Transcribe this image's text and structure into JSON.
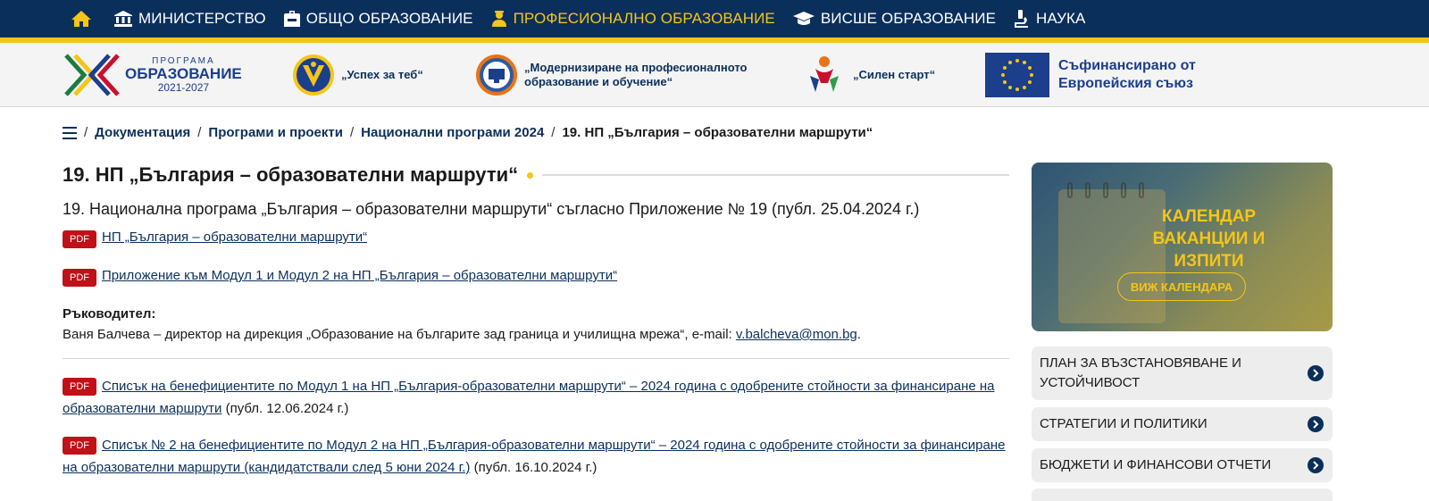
{
  "topnav": {
    "items": [
      {
        "label": "Министерство",
        "icon": "institution-icon"
      },
      {
        "label": "Общо образование",
        "icon": "backpack-icon"
      },
      {
        "label": "Професионално образование",
        "icon": "worker-icon",
        "active": true
      },
      {
        "label": "Висше образование",
        "icon": "graduation-cap-icon"
      },
      {
        "label": "Наука",
        "icon": "microscope-icon"
      }
    ]
  },
  "logos": {
    "programa": {
      "line1": "ПРОГРАМА",
      "line2": "ОБРАЗОВАНИЕ",
      "line3": "2021-2027"
    },
    "uspeh": "„Успех за теб“",
    "moder_line1": "„Модернизиране на професионалното",
    "moder_line2": "образование и обучение“",
    "silen": "„Силен старт“",
    "eu_line1": "Съфинансирано от",
    "eu_line2": "Европейския съюз"
  },
  "breadcrumb": {
    "items": [
      "Документация",
      "Програми и проекти",
      "Национални програми 2024"
    ],
    "current": "19. НП „България – образователни маршрути“"
  },
  "main": {
    "title": "19. НП „България – образователни маршрути“",
    "subtitle": "19. Национална програма „България – образователни маршрути“ съгласно Приложение № 19 (публ. 25.04.2024 г.)",
    "pdf_badge": "PDF",
    "doc1": "НП „България – образователни маршрути“",
    "doc2": "Приложение към Модул 1 и Модул 2 на НП „България – образователни маршрути“",
    "leader_label": "Ръководител:",
    "leader_text": "Ваня Балчева – директор на дирекция „Образование на българите зад граница и училищна мрежа“, e-mail: ",
    "leader_email": "v.balcheva@mon.bg",
    "leader_end": ".",
    "doc3": "Списък на бенефициентите по Модул 1 на НП „България-образователни маршрути“ – 2024 година с одобрените стойности за финансиране на образователни маршрути",
    "doc3_note": " (публ. 12.06.2024 г.)",
    "doc4": "Списък № 2 на бенефициентите по Модул 2 на НП „България-образователни маршрути“ – 2024 година с одобрените стойности за финансиране на образователни маршрути (кандидатствали след 5 юни 2024 г.)",
    "doc4_note": " (публ. 16.10.2024 г.)"
  },
  "sidebar": {
    "calendar_title_1": "КАЛЕНДАР",
    "calendar_title_2": "ВАКАНЦИИ И",
    "calendar_title_3": "ИЗПИТИ",
    "calendar_button": "ВИЖ КАЛЕНДАРА",
    "links": [
      "План за възстановяване и устойчивост",
      "Стратегии и политики",
      "Бюджети и финансови отчети",
      ""
    ]
  },
  "colors": {
    "navy": "#0b2f5b",
    "yellow": "#f5c518",
    "pdf_red": "#c01018"
  }
}
